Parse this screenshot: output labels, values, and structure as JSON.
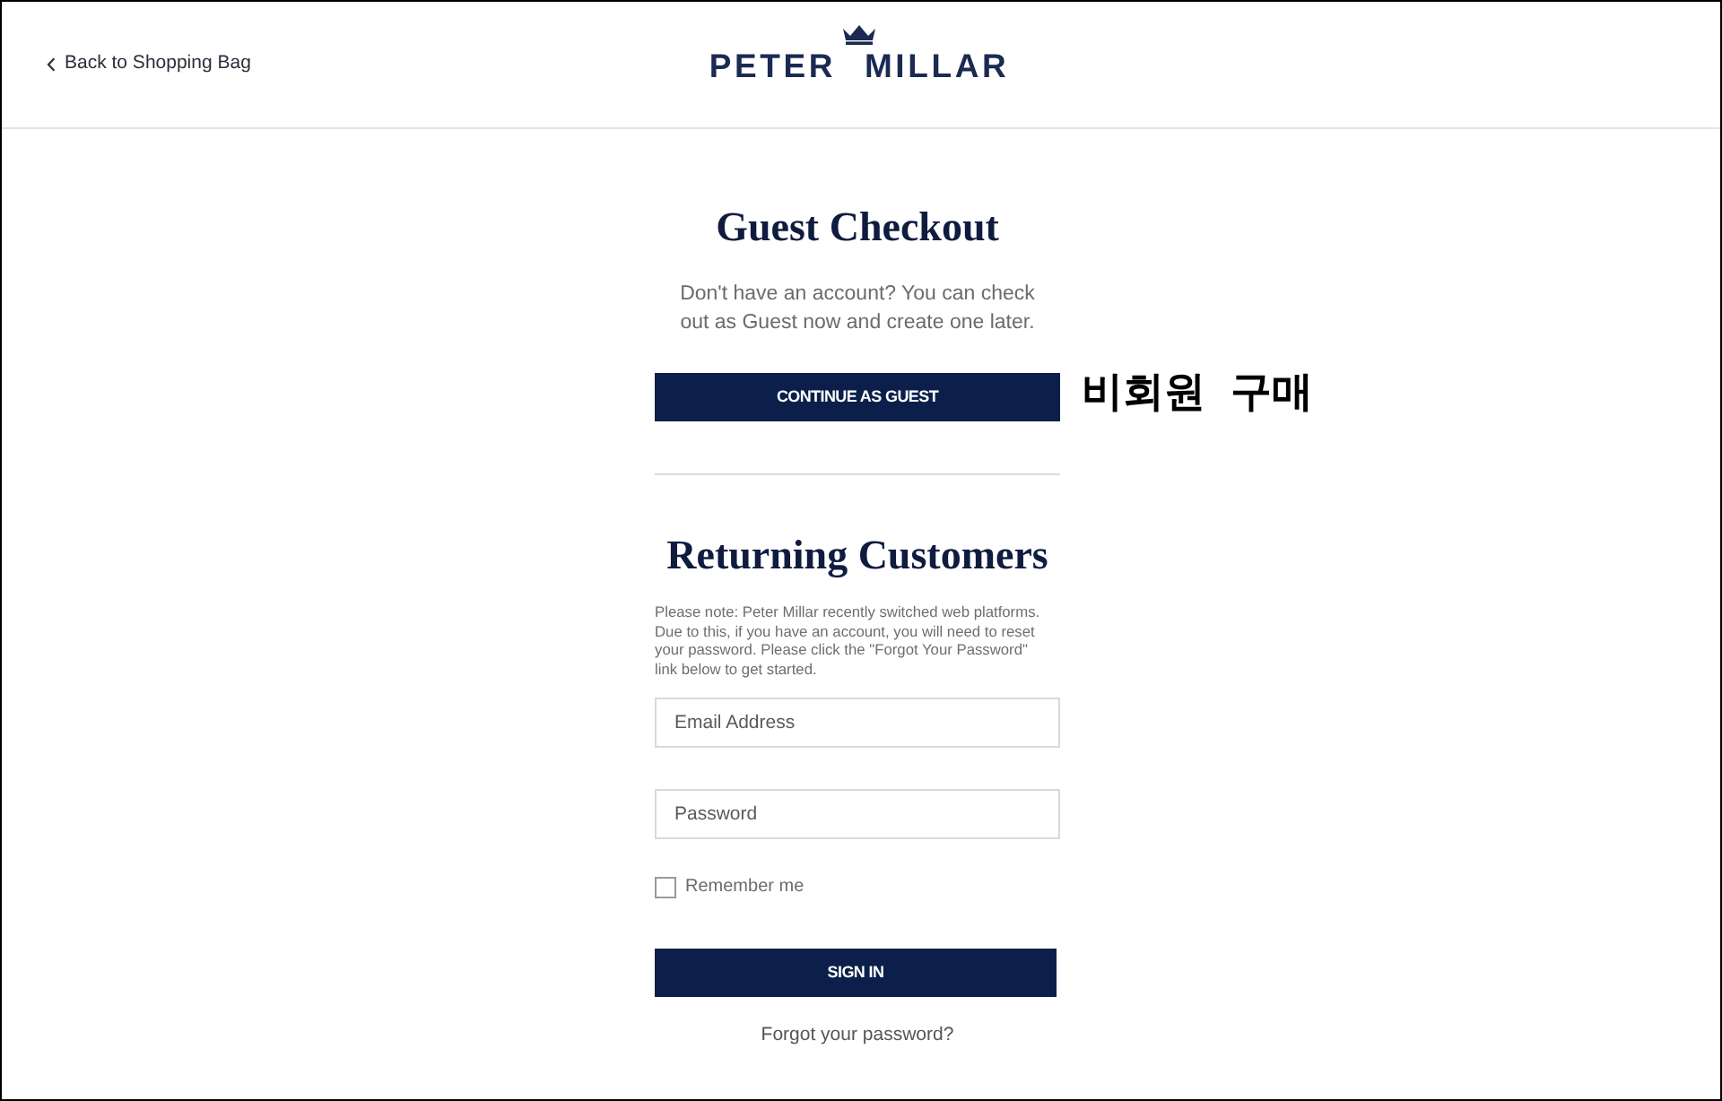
{
  "header": {
    "back_link": "Back to Shopping Bag",
    "logo": "PETER MILLAR"
  },
  "guest": {
    "title": "Guest Checkout",
    "text": "Don't have an account? You can check out as Guest now and create one later.",
    "button": "CONTINUE AS GUEST",
    "annotation": "비회원 구매"
  },
  "returning": {
    "title": "Returning Customers",
    "note": "Please note: Peter Millar recently switched web platforms. Due to this, if you have an account, you will need to reset your password. Please click the \"Forgot Your Password\" link below to get started.",
    "fields": [
      {
        "placeholder": "Email Address"
      },
      {
        "placeholder": "Password"
      }
    ],
    "remember": {
      "label": "Remember me",
      "checked": false
    },
    "button": "SIGN IN",
    "forgot_link": "Forgot your password?"
  }
}
